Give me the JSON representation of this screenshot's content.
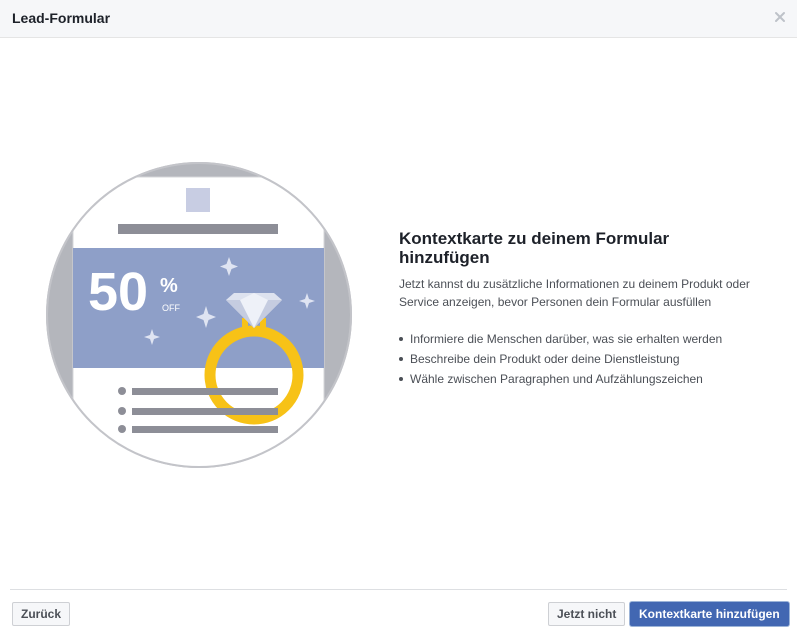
{
  "dialog": {
    "title": "Lead-Formular",
    "close_icon": "close-icon"
  },
  "illustration": {
    "percent_value": "50",
    "percent_sign": "%",
    "off_label": "OFF",
    "colors": {
      "circle": "#b4b6bc",
      "banner": "#8e9fc8",
      "ring": "#f7c217",
      "bars": "#8d8e97",
      "logo": "#c8cde3"
    }
  },
  "content": {
    "heading": "Kontextkarte zu deinem Formular hinzufügen",
    "description": "Jetzt kannst du zusätzliche Informationen zu deinem Produkt oder Service anzeigen, bevor Personen dein Formular ausfüllen",
    "bullets": [
      "Informiere die Menschen darüber, was sie erhalten werden",
      "Beschreibe dein Produkt oder deine Dienstleistung",
      "Wähle zwischen Paragraphen und Aufzählungszeichen"
    ]
  },
  "footer": {
    "back_label": "Zurück",
    "not_now_label": "Jetzt nicht",
    "add_label": "Kontextkarte hinzufügen"
  }
}
